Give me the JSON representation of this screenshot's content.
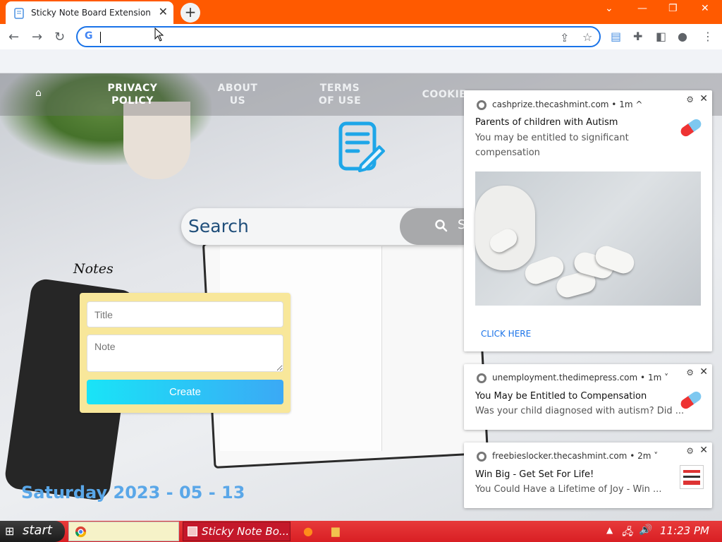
{
  "browser": {
    "tab_title": "Sticky Note Board Extension",
    "new_tab_label": "+",
    "address_value": ""
  },
  "site": {
    "nav": [
      {
        "label_line1": "PRIVACY",
        "label_line2": "POLICY"
      },
      {
        "label_line1": "ABOUT",
        "label_line2": "US"
      },
      {
        "label_line1": "TERMS",
        "label_line2": "OF USE"
      },
      {
        "label_line1": "COOKIE",
        "label_line2": ""
      }
    ],
    "search_placeholder": "Search",
    "search_button_fragment": "S",
    "notes_heading": "Notes",
    "title_placeholder": "Title",
    "note_placeholder": "Note",
    "create_label": "Create",
    "date": "Saturday 2023 - 05 - 13"
  },
  "notifications": [
    {
      "source": "cashprize.thecashmint.com",
      "age": "• 1m ^",
      "title": "Parents of children with Autism",
      "body_line1": "You may be entitled to significant",
      "body_line2": "compensation",
      "action": "CLICK HERE"
    },
    {
      "source": "unemployment.thedimepress.com",
      "age": "• 1m ˅",
      "title": "You May be Entitled to Compensation",
      "body_line1": "Was your child diagnosed with autism? Did ..."
    },
    {
      "source": "freebieslocker.thecashmint.com",
      "age": "• 2m ˅",
      "title": "Win Big - Get Set For Life!",
      "body_line1": "You Could Have a Lifetime of Joy - Win ..."
    }
  ],
  "taskbar": {
    "start_label": "start",
    "sticky_task": "Sticky Note Bo...",
    "clock": "11:23 PM"
  },
  "colors": {
    "titlebar": "#ff5a00",
    "taskbar": "#d91f24",
    "date_text": "#5aa7e8",
    "note_card": "#f8e79a"
  }
}
